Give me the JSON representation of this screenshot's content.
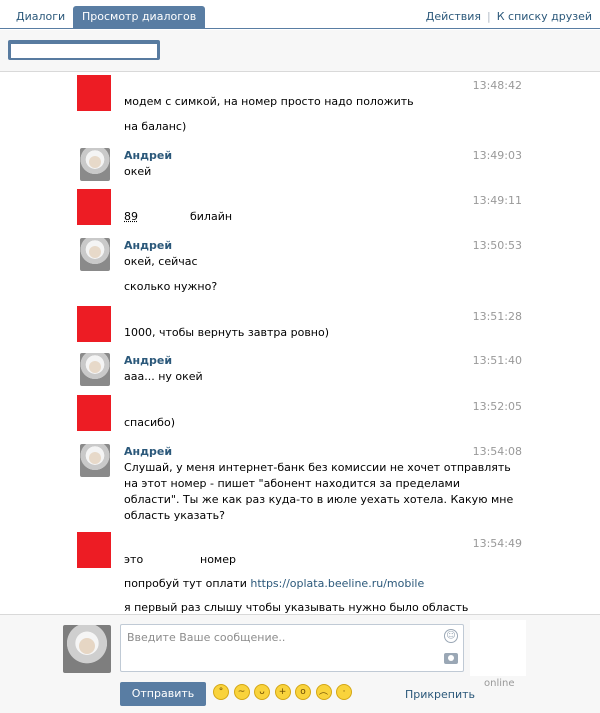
{
  "tabs": [
    {
      "label": "Диалоги"
    },
    {
      "label": "Просмотр диалогов"
    }
  ],
  "top_links": {
    "actions": "Действия",
    "to_friends": "К списку друзей"
  },
  "search": {
    "value": ""
  },
  "messages": [
    {
      "author": "",
      "time": "13:48:42",
      "lines": [
        "модем с симкой, на номер просто надо положить",
        "на баланс)"
      ]
    },
    {
      "author": "Андрей",
      "time": "13:49:03",
      "lines": [
        "окей"
      ]
    },
    {
      "author": "",
      "time": "13:49:11",
      "lines": [
        "89",
        "билайн"
      ]
    },
    {
      "author": "Андрей",
      "time": "13:50:53",
      "lines": [
        "окей, сейчас",
        "сколько нужно?"
      ]
    },
    {
      "author": "",
      "time": "13:51:28",
      "lines": [
        "1000, чтобы вернуть завтра ровно)"
      ]
    },
    {
      "author": "Андрей",
      "time": "13:51:40",
      "lines": [
        "ааа... ну окей"
      ]
    },
    {
      "author": "",
      "time": "13:52:05",
      "lines": [
        "спасибо)"
      ]
    },
    {
      "author": "Андрей",
      "time": "13:54:08",
      "lines": [
        "Слушай, у меня интернет-банк без комиссии не хочет отправлять",
        "на этот номер - пишет \"абонент находится за пределами",
        "области\". Ты же как раз куда-то в июле уехать хотела. Какую мне",
        "область указать?"
      ]
    },
    {
      "author": "",
      "time": "13:54:49",
      "lines": [
        "это",
        "номер",
        "попробуй тут оплати ",
        "https://oplata.beeline.ru/mobile",
        "я первый раз слышу чтобы указывать нужно было область"
      ]
    }
  ],
  "composer": {
    "placeholder": "Введите Ваше сообщение..",
    "send_label": "Отправить",
    "attach_label": "Прикрепить",
    "online_label": "online",
    "emoji_icons": [
      "scared-face",
      "wink-face",
      "grin-face",
      "thumbs-up",
      "surprised-face",
      "sad-face",
      "blush-face"
    ]
  },
  "colors": {
    "accent": "#597da3",
    "link": "#2b587a",
    "redacted": "#ed1c24"
  }
}
